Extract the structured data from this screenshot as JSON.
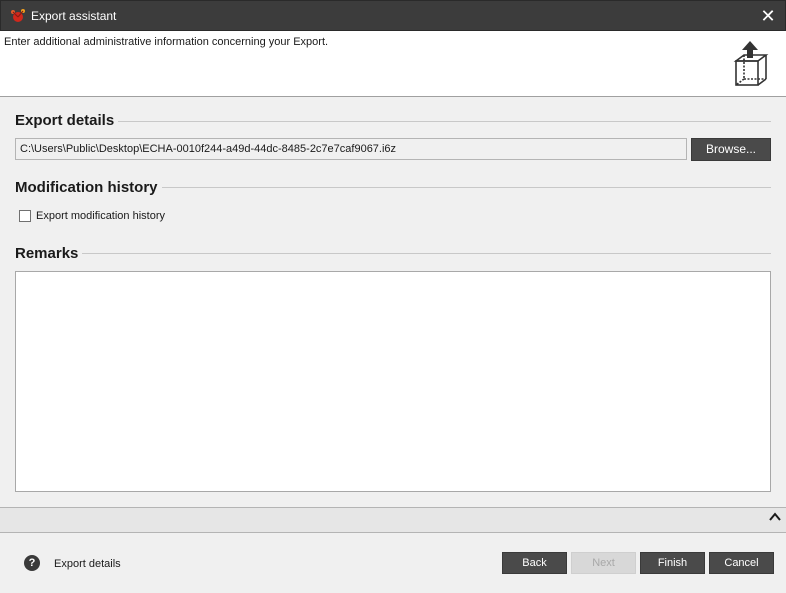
{
  "window": {
    "title": "Export assistant",
    "close_glyph": "✕"
  },
  "banner": {
    "description": "Enter additional administrative information concerning your Export.",
    "icon": "export-box-icon"
  },
  "export_details": {
    "heading": "Export details",
    "path_value": "C:\\Users\\Public\\Desktop\\ECHA-0010f244-a49d-44dc-8485-2c7e7caf9067.i6z",
    "browse_label": "Browse..."
  },
  "modification_history": {
    "heading": "Modification history",
    "checkbox_label": "Export modification history",
    "checked": false
  },
  "remarks": {
    "heading": "Remarks",
    "value": ""
  },
  "footer": {
    "help_glyph": "?",
    "help_label": "Export details",
    "back_label": "Back",
    "next_label": "Next",
    "finish_label": "Finish",
    "cancel_label": "Cancel"
  },
  "colors": {
    "titlebar": "#3c3c3c",
    "button": "#4a4a4a",
    "button_disabled": "#d8d8d8",
    "accent_icon": "#d0281c"
  }
}
